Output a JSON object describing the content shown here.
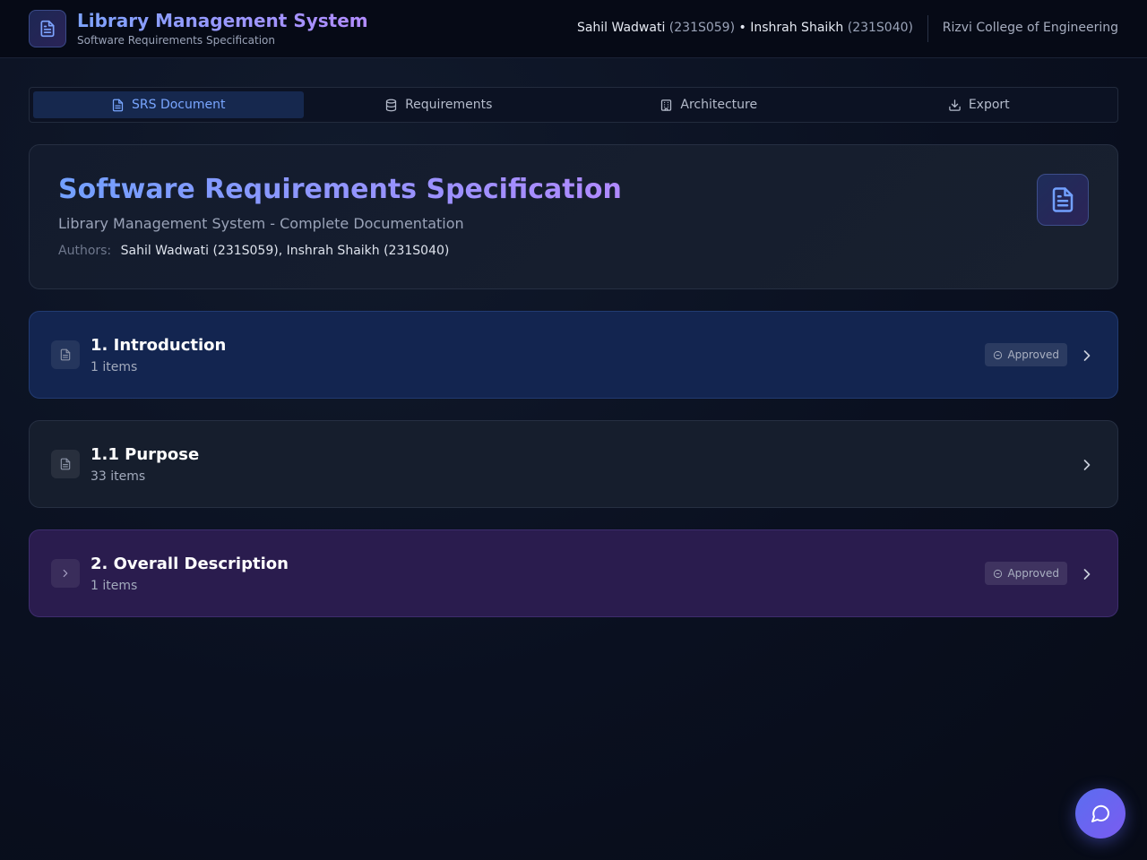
{
  "header": {
    "title": "Library Management System",
    "subtitle": "Software Requirements Specification",
    "author1_name": "Sahil Wadwati",
    "author1_id": "(231S059)",
    "separator": "•",
    "author2_name": "Inshrah Shaikh",
    "author2_id": "(231S040)",
    "college": "Rizvi College of Engineering",
    "logo_icon": "file-text-icon"
  },
  "tabs": [
    {
      "label": "SRS Document",
      "icon": "file-text-icon",
      "active": true
    },
    {
      "label": "Requirements",
      "icon": "database-icon",
      "active": false
    },
    {
      "label": "Architecture",
      "icon": "building-icon",
      "active": false
    },
    {
      "label": "Export",
      "icon": "download-icon",
      "active": false
    }
  ],
  "hero": {
    "title": "Software Requirements Specification",
    "subtitle": "Library Management System - Complete Documentation",
    "authors_label": "Authors:",
    "authors_value": "Sahil Wadwati (231S059), Inshrah Shaikh (231S040)",
    "icon": "file-text-icon"
  },
  "sections": [
    {
      "title": "1. Introduction",
      "count": "1 items",
      "badge": "Approved",
      "icon": "file-text-icon"
    },
    {
      "title": "1.1 Purpose",
      "count": "33 items",
      "badge": "",
      "icon": "file-text-icon"
    },
    {
      "title": "2. Overall Description",
      "count": "1 items",
      "badge": "Approved",
      "icon": "chevron-right-icon"
    }
  ],
  "colors": {
    "accent_blue": "#79a6ff",
    "accent_purple": "#b08aff",
    "background": "#0a1020"
  },
  "chat": {
    "icon": "chat-bubble-icon"
  }
}
